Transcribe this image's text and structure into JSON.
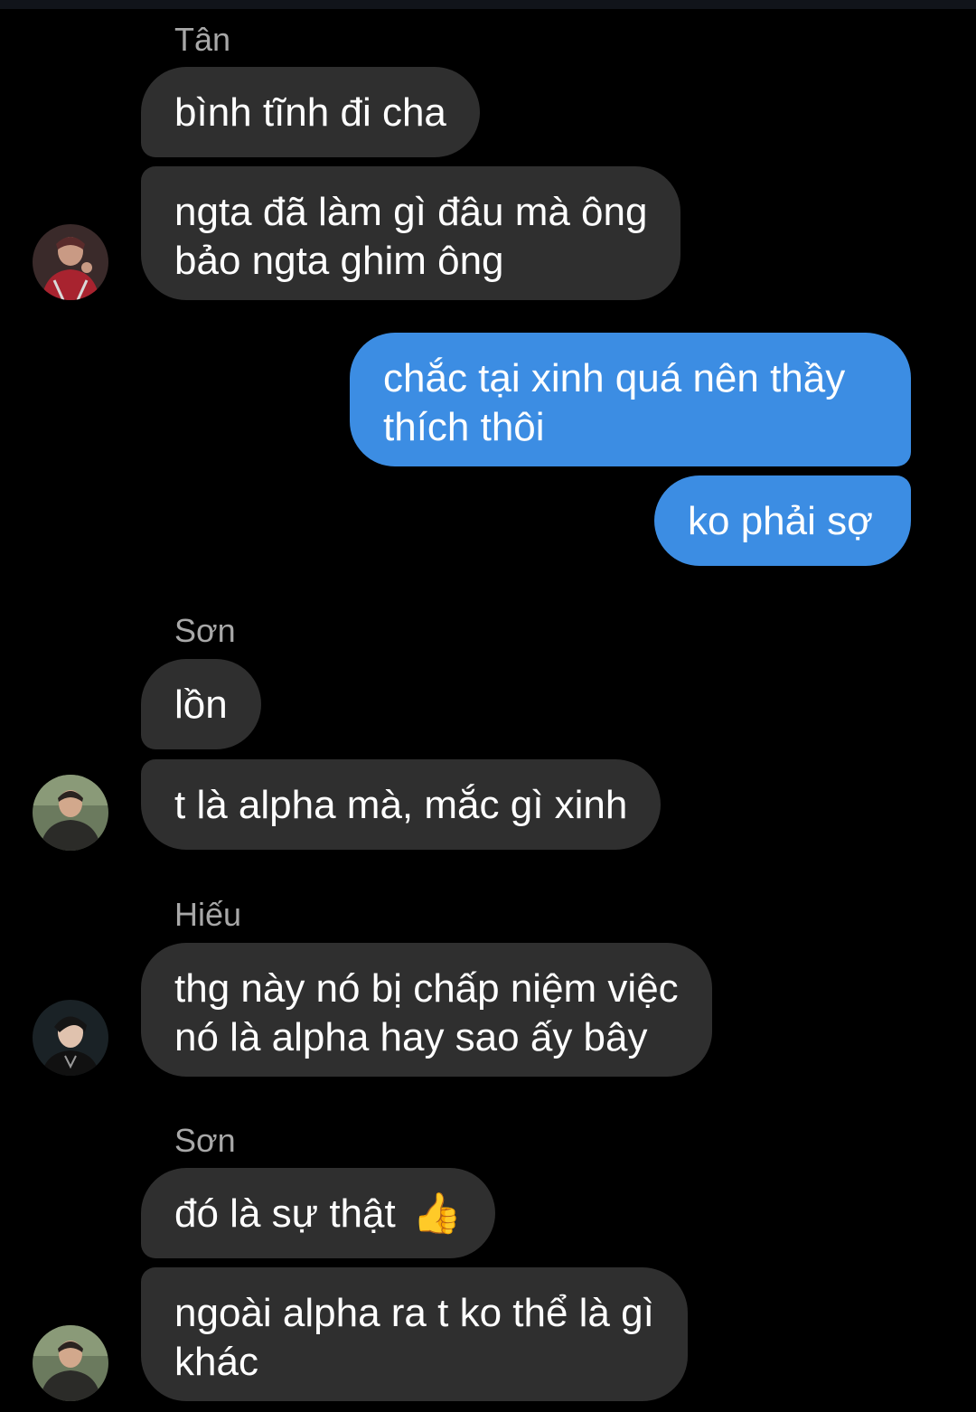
{
  "colors": {
    "background": "#000000",
    "incoming_bubble": "#2f2f2f",
    "outgoing_bubble": "#3c8de3",
    "sender_name": "#a8a8a8",
    "text": "#ffffff"
  },
  "conversation": {
    "groups": [
      {
        "sender": "Tân",
        "direction": "incoming",
        "avatar": "avatar-tan",
        "messages": [
          "bình tĩnh đi cha",
          "ngta đã làm gì đâu mà ông bảo ngta ghim ông"
        ]
      },
      {
        "sender": "",
        "direction": "outgoing",
        "messages": [
          "chắc tại xinh quá nên thầy thích thôi",
          "ko phải sợ"
        ]
      },
      {
        "sender": "Sơn",
        "direction": "incoming",
        "avatar": "avatar-son",
        "messages": [
          "lồn",
          "t là alpha mà, mắc gì xinh"
        ]
      },
      {
        "sender": "Hiếu",
        "direction": "incoming",
        "avatar": "avatar-hieu",
        "messages": [
          "thg này nó bị chấp niệm việc nó là alpha hay sao ấy bây"
        ]
      },
      {
        "sender": "Sơn",
        "direction": "incoming",
        "avatar": "avatar-son",
        "messages": [
          "đó là sự thật 👍",
          "ngoài alpha ra t ko thể là gì khác"
        ]
      }
    ],
    "line_breaks": {
      "msg_1_2": [
        "ngta đã làm gì đâu mà ông",
        "bảo ngta ghim ông"
      ],
      "msg_2_1": [
        "chắc tại xinh quá nên thầy",
        "thích thôi"
      ],
      "msg_4_1": [
        "thg này nó bị chấp niệm việc",
        "nó là alpha hay sao ấy bây"
      ],
      "msg_5_1_text": "đó là sự thật",
      "msg_5_1_emoji": "👍",
      "msg_5_2": [
        "ngoài alpha ra t ko thể là gì",
        "khác"
      ]
    }
  }
}
